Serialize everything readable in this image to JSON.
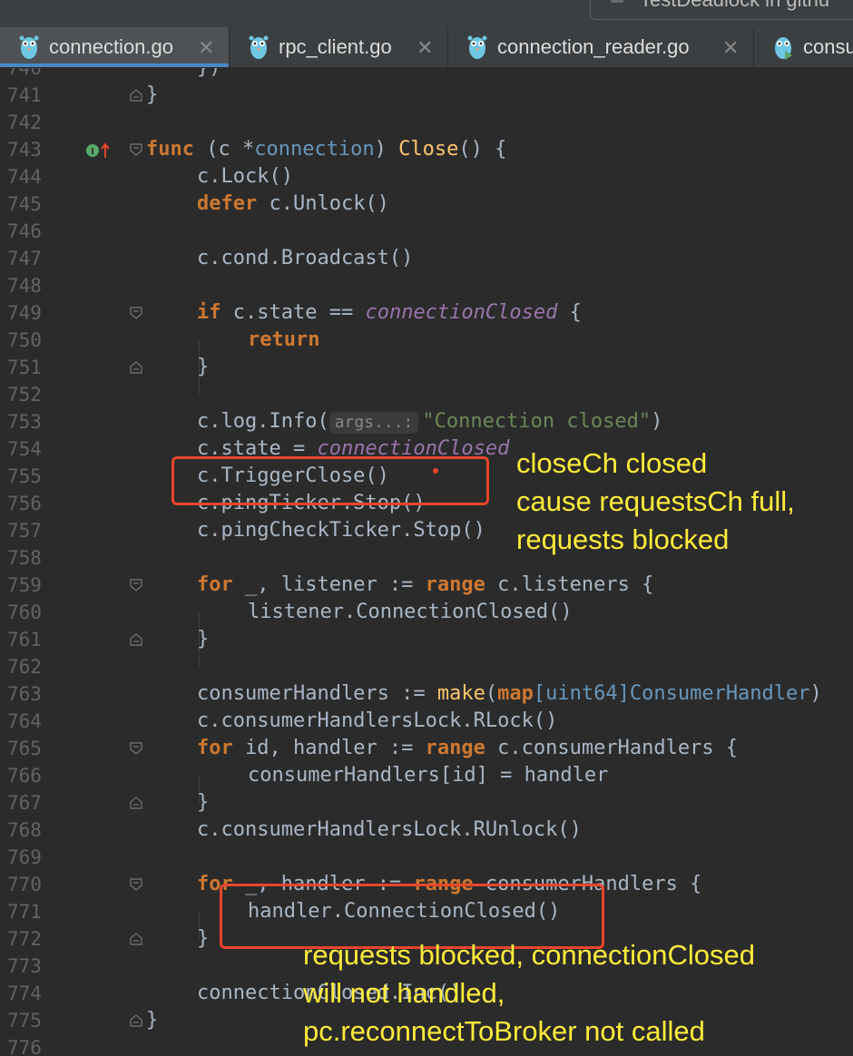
{
  "run_config": {
    "label": "TestDeadlock in githu"
  },
  "tabs": [
    {
      "label": "connection.go"
    },
    {
      "label": "rpc_client.go"
    },
    {
      "label": "connection_reader.go"
    },
    {
      "label": "consu"
    }
  ],
  "line_numbers": [
    "740",
    "741",
    "742",
    "743",
    "744",
    "745",
    "746",
    "747",
    "748",
    "749",
    "750",
    "751",
    "752",
    "753",
    "754",
    "755",
    "756",
    "757",
    "758",
    "759",
    "760",
    "761",
    "762",
    "763",
    "764",
    "765",
    "766",
    "767",
    "768",
    "769",
    "770",
    "771",
    "772",
    "773",
    "774",
    "775",
    "776"
  ],
  "code": {
    "l740": "})",
    "l741": "}",
    "l743": {
      "kw": "func",
      "recv_open": "(c *",
      "recv_type": "connection",
      "recv_close": ") ",
      "name": "Close",
      "rest": "() {"
    },
    "l744": "c.Lock()",
    "l745": {
      "kw": "defer",
      "rest": " c.Unlock()"
    },
    "l747": "c.cond.Broadcast()",
    "l749": {
      "kw": "if",
      "mid": " c.state == ",
      "const": "connectionClosed",
      "rest": " {"
    },
    "l750": {
      "kw": "return"
    },
    "l751": "}",
    "l753": {
      "pre": "c.log.Info(",
      "hint": "args...:",
      "str": "\"Connection closed\"",
      "rest": ")"
    },
    "l754": {
      "pre": "c.state = ",
      "const": "connectionClosed"
    },
    "l755": "c.TriggerClose()",
    "l756": "c.pingTicker.Stop()",
    "l757": "c.pingCheckTicker.Stop()",
    "l759": {
      "kw": "for",
      "mid": " _, listener := ",
      "kw2": "range",
      "rest": " c.listeners {"
    },
    "l760": "listener.ConnectionClosed()",
    "l761": "}",
    "l763": {
      "pre": "consumerHandlers := ",
      "blt": "make",
      "open": "(",
      "kw": "map",
      "typ": "[uint64]ConsumerHandler",
      "rest": ")"
    },
    "l764": "c.consumerHandlersLock.RLock()",
    "l765": {
      "kw": "for",
      "mid": " id, handler := ",
      "kw2": "range",
      "rest": " c.consumerHandlers {"
    },
    "l766": "consumerHandlers[id] = handler",
    "l767": "}",
    "l768": "c.consumerHandlersLock.RUnlock()",
    "l770": {
      "kw": "for",
      "mid": " _, handler := ",
      "kw2": "range",
      "rest": " consumerHandlers {"
    },
    "l771": "handler.ConnectionClosed()",
    "l772": "}",
    "l774": "connectionClosed.Inc()",
    "l775": "}"
  },
  "annotations": {
    "note1": [
      "closeCh closed",
      "cause requestsCh full,",
      "requests blocked"
    ],
    "note2": [
      "requests blocked, connectionClosed",
      "will not handled,",
      "pc.reconnectToBroker not called"
    ]
  },
  "colors": {
    "background": "#2b2b2b",
    "keyword": "#cc7832",
    "function": "#ffc66d",
    "type": "#6897bb",
    "constant": "#9876aa",
    "string": "#6a8759",
    "annotation_box": "#e8452c",
    "annotation_text": "#ffec3a"
  }
}
